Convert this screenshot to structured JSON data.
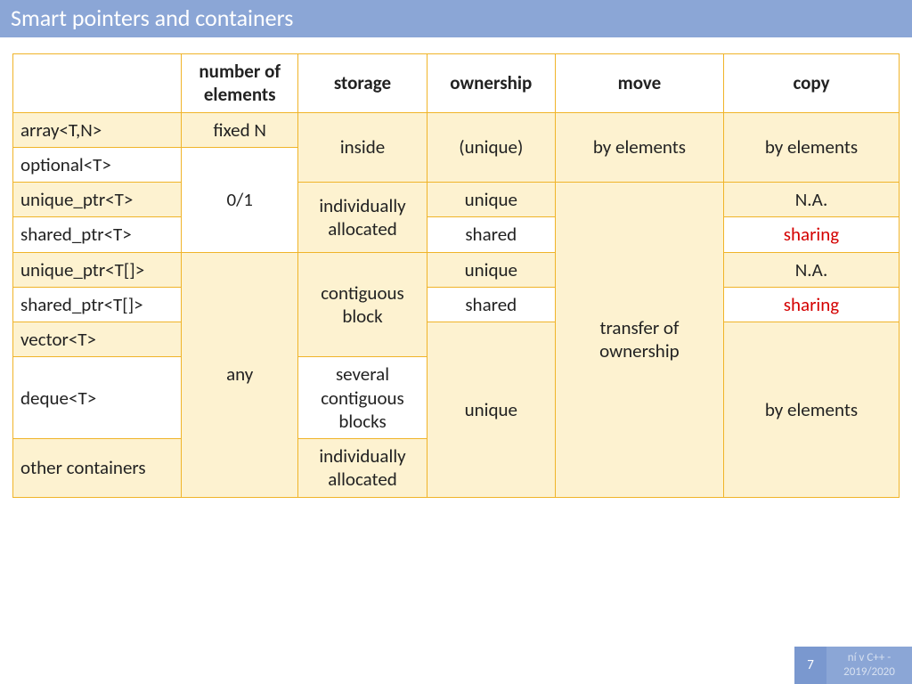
{
  "title": "Smart pointers and containers",
  "headers": {
    "col0": "",
    "col1": "number of elements",
    "col2": "storage",
    "col3": "ownership",
    "col4": "move",
    "col5": "copy"
  },
  "rows": {
    "array": "array<T,N>",
    "optional": "optional<T>",
    "unique_ptr": "unique_ptr<T>",
    "shared_ptr": "shared_ptr<T>",
    "unique_ptr_arr": "unique_ptr<T[]>",
    "shared_ptr_arr": "shared_ptr<T[]>",
    "vector": "vector<T>",
    "deque": "deque<T>",
    "other": "other containers"
  },
  "cells": {
    "fixedN": "fixed N",
    "zero_one": "0/1",
    "any": "any",
    "inside": "inside",
    "individually_allocated": "individually allocated",
    "contiguous_block": "contiguous block",
    "several_contiguous_blocks": "several contiguous blocks",
    "unique_paren": "(unique)",
    "unique": "unique",
    "shared": "shared",
    "by_elements": "by elements",
    "transfer_of_ownership": "transfer of ownership",
    "na": "N.A.",
    "sharing": "sharing"
  },
  "footer": {
    "page": "7",
    "text1": "ní v C++ -",
    "text2": "2019/2020"
  }
}
